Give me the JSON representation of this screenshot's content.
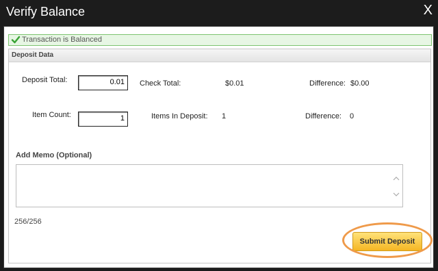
{
  "window": {
    "title": "Verify Balance",
    "close_label": "X"
  },
  "status": {
    "text": "Transaction is Balanced",
    "icon": "check-icon",
    "color": "#4caf50"
  },
  "section": {
    "title": "Deposit Data"
  },
  "deposit": {
    "deposit_total_label": "Deposit Total:",
    "deposit_total_value": "0.01",
    "check_total_label": "Check Total:",
    "check_total_value": "$0.01",
    "difference1_label": "Difference:",
    "difference1_value": "$0.00",
    "item_count_label": "Item Count:",
    "item_count_value": "1",
    "items_in_deposit_label": "Items In Deposit:",
    "items_in_deposit_value": "1",
    "difference2_label": "Difference:",
    "difference2_value": "0"
  },
  "memo": {
    "label": "Add Memo (Optional)",
    "value": "",
    "counter": "256/256"
  },
  "actions": {
    "submit_label": "Submit Deposit",
    "accent": "#f5b623",
    "highlight": "#ef9a4a"
  }
}
